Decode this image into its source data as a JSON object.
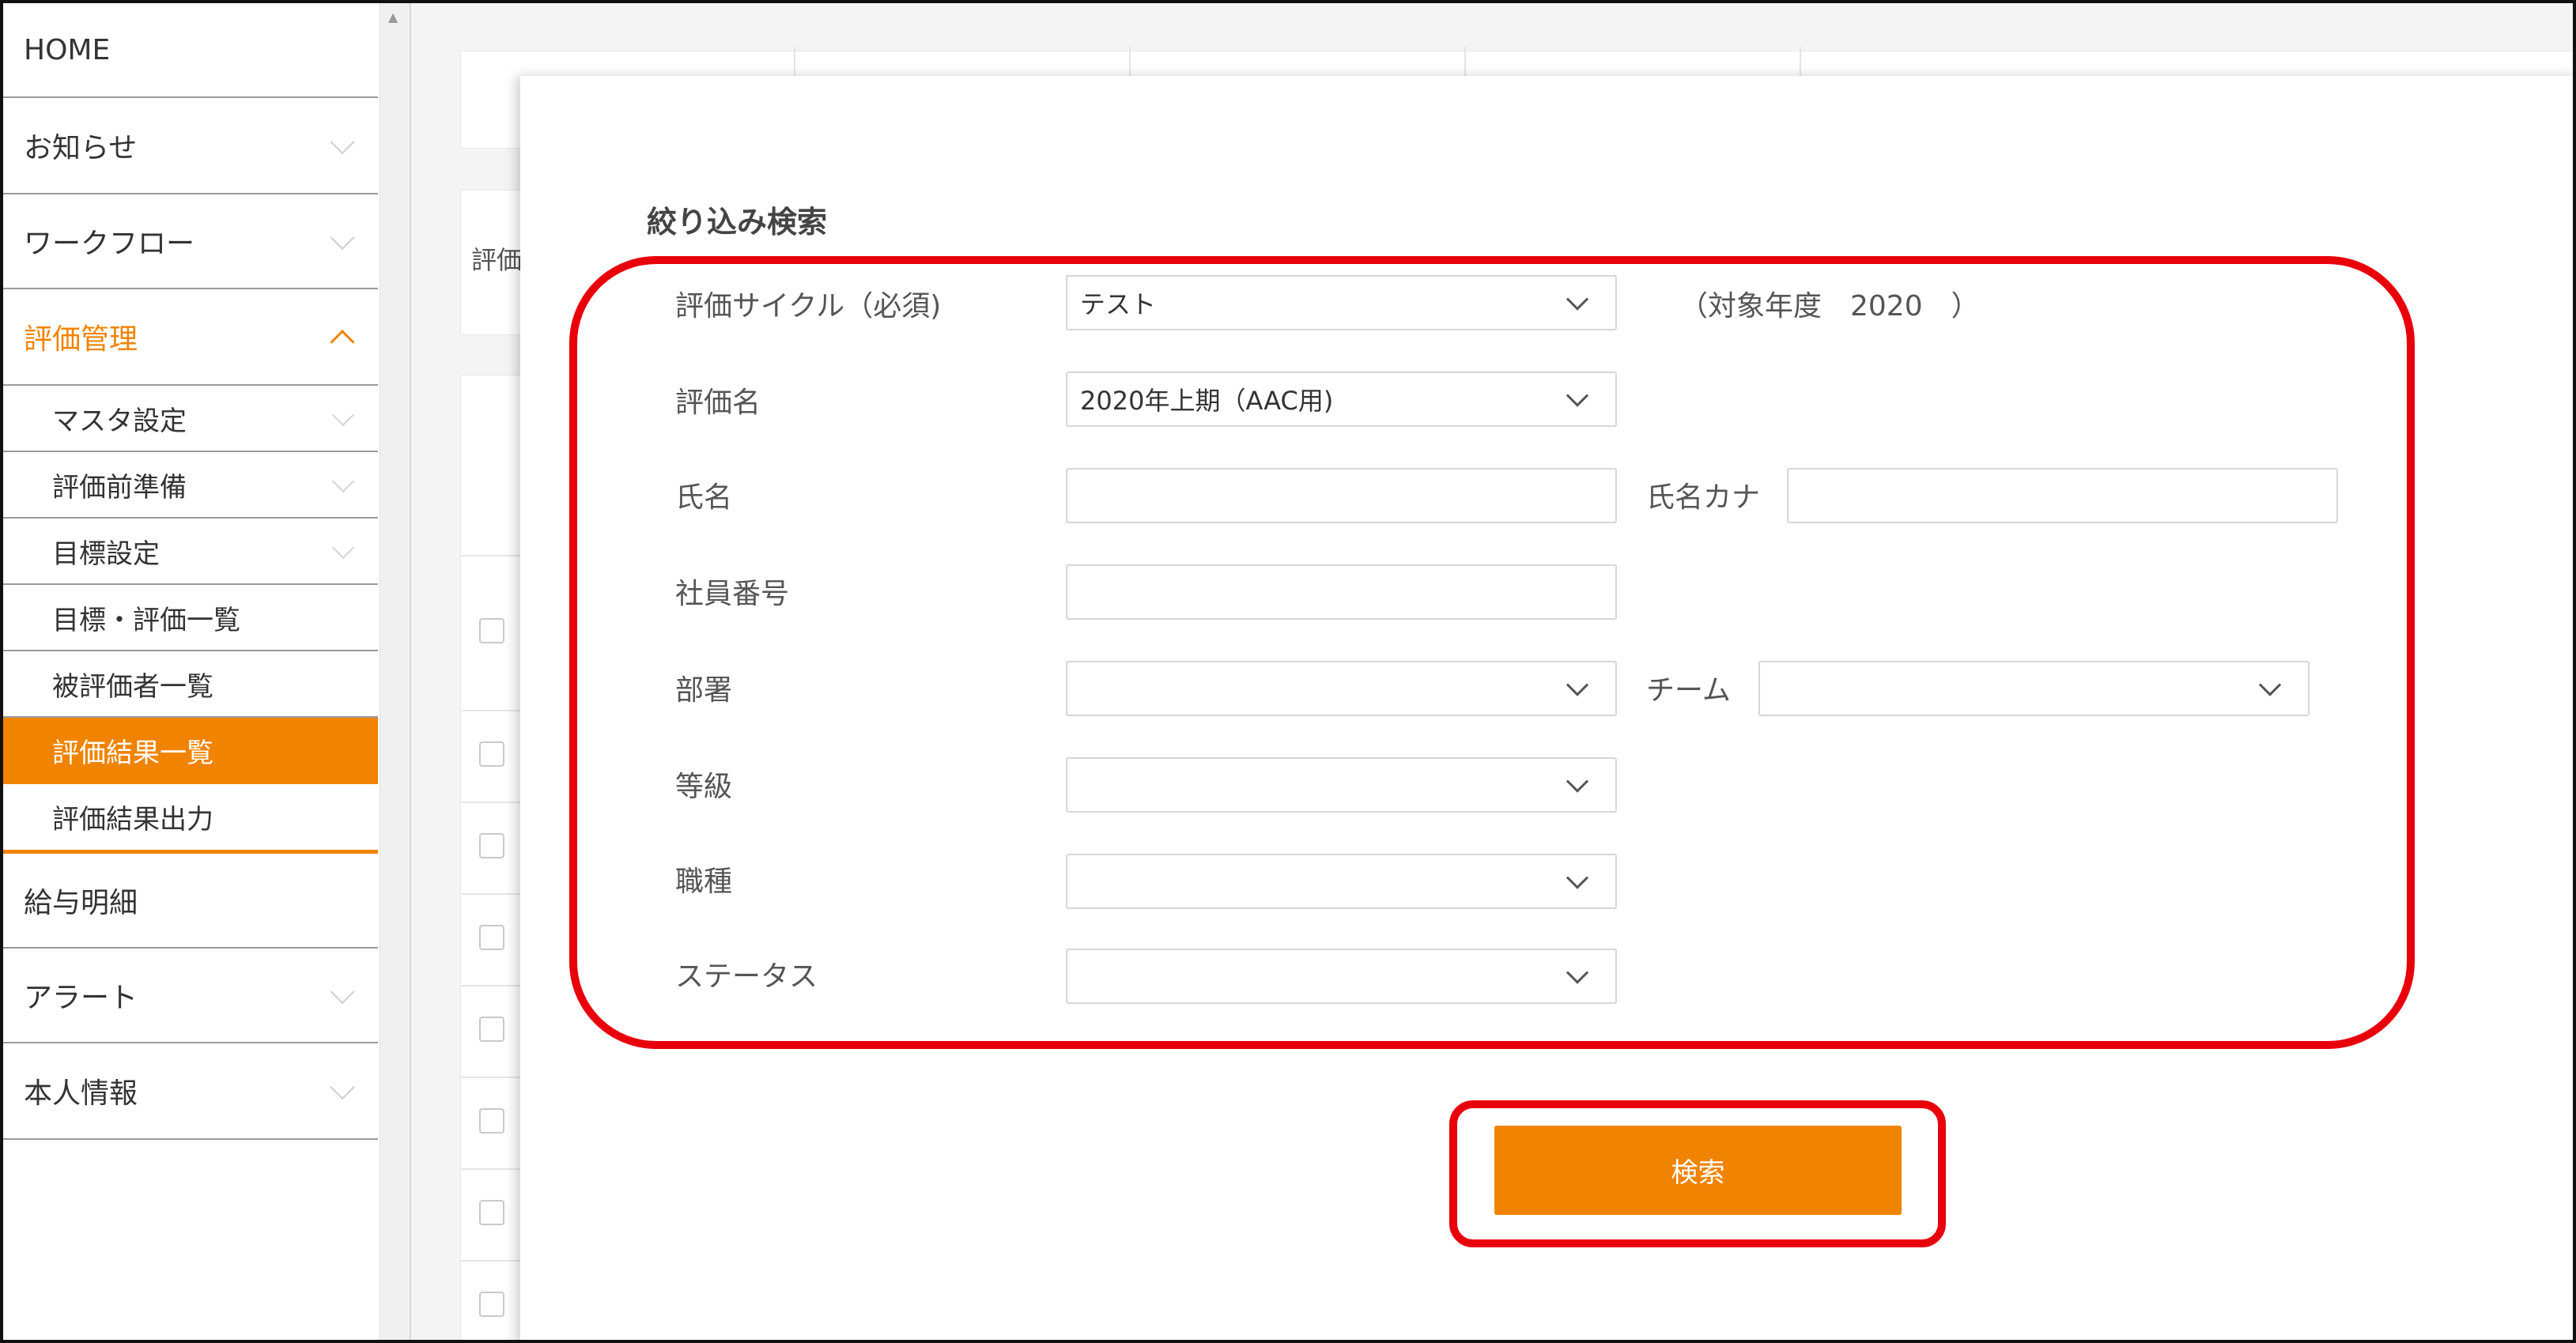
{
  "sidebar": {
    "items": [
      {
        "label": "HOME"
      },
      {
        "label": "お知らせ"
      },
      {
        "label": "ワークフロー"
      },
      {
        "label": "評価管理"
      },
      {
        "label": "給与明細"
      },
      {
        "label": "アラート"
      },
      {
        "label": "本人情報"
      }
    ],
    "sub_items": [
      {
        "label": "マスタ設定"
      },
      {
        "label": "評価前準備"
      },
      {
        "label": "目標設定"
      },
      {
        "label": "目標・評価一覧"
      },
      {
        "label": "被評価者一覧"
      },
      {
        "label": "評価結果一覧"
      },
      {
        "label": "評価結果出力"
      }
    ]
  },
  "background": {
    "partial_label": "評価"
  },
  "modal": {
    "title": "絞り込み検索",
    "fields": {
      "cycle": {
        "label": "評価サイクル（必須)",
        "value": "テスト"
      },
      "target_year": {
        "text": "（対象年度　2020　）"
      },
      "eval_name": {
        "label": "評価名",
        "value": "2020年上期（AAC用)"
      },
      "name": {
        "label": "氏名",
        "value": ""
      },
      "name_kana": {
        "label": "氏名カナ",
        "value": ""
      },
      "employee_no": {
        "label": "社員番号",
        "value": ""
      },
      "department": {
        "label": "部署",
        "value": ""
      },
      "team": {
        "label": "チーム",
        "value": ""
      },
      "grade": {
        "label": "等級",
        "value": ""
      },
      "job_type": {
        "label": "職種",
        "value": ""
      },
      "status": {
        "label": "ステータス",
        "value": ""
      }
    },
    "search_button": "検索"
  },
  "colors": {
    "accent": "#f08300",
    "highlight": "#e8000b"
  }
}
